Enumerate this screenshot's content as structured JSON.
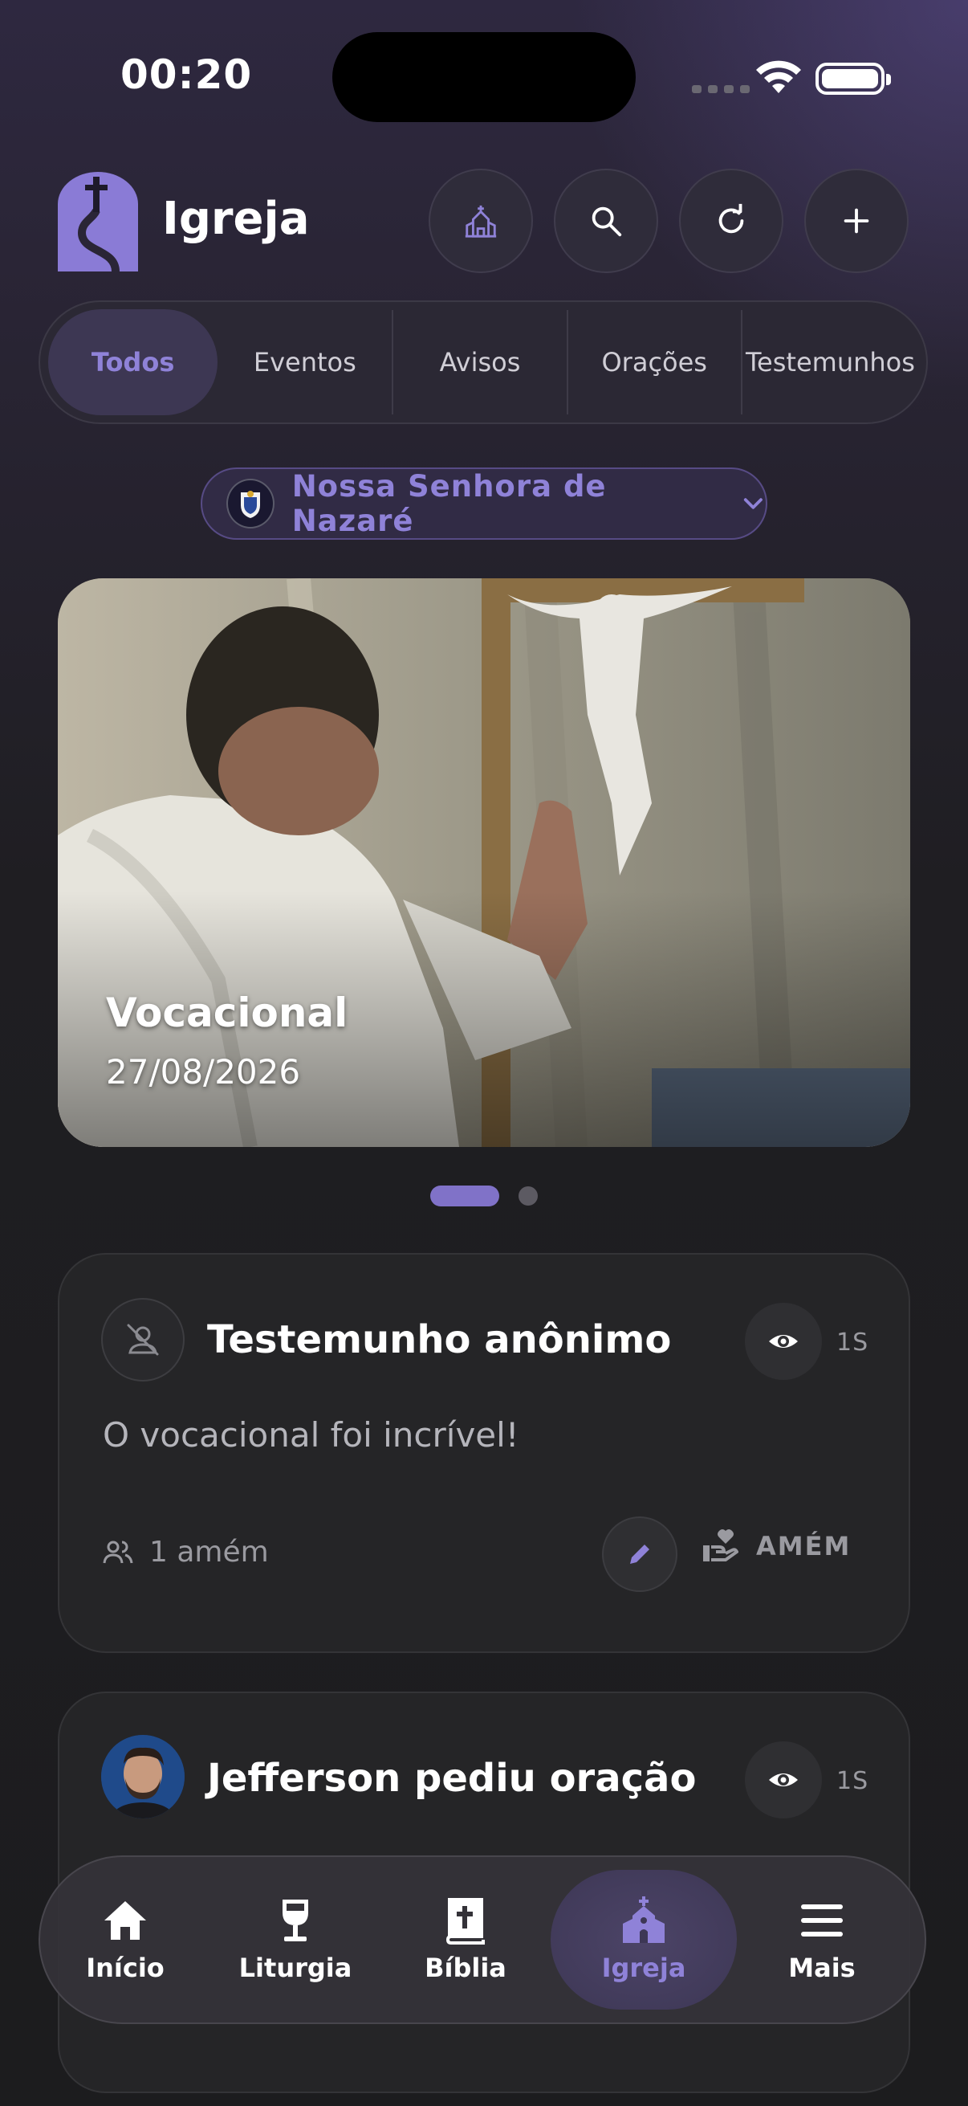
{
  "status_bar": {
    "time": "00:20"
  },
  "header": {
    "title": "Igreja",
    "buttons": [
      {
        "icon": "church-icon"
      },
      {
        "icon": "search-icon"
      },
      {
        "icon": "refresh-icon"
      },
      {
        "icon": "plus-icon"
      }
    ]
  },
  "filters": {
    "tabs": [
      {
        "label": "Todos",
        "active": true
      },
      {
        "label": "Eventos"
      },
      {
        "label": "Avisos"
      },
      {
        "label": "Orações"
      },
      {
        "label": "Testemunhos"
      }
    ]
  },
  "parish_selector": {
    "name": "Nossa Senhora de Nazaré",
    "icon": "chevron-down-icon"
  },
  "carousel": {
    "slides": [
      {
        "title": "Vocacional",
        "date": "27/08/2026"
      }
    ],
    "active_index": 0,
    "count": 2
  },
  "feed": [
    {
      "author_label": "Testemunho anônimo",
      "time_ago": "1S",
      "body": "O vocacional foi incrível!",
      "amen_count": "1 amém",
      "amen_button": "AMÉM"
    },
    {
      "author_label": "Jefferson pediu oração",
      "time_ago": "1S"
    }
  ],
  "bottom_nav": {
    "items": [
      {
        "label": "Início",
        "icon": "home-icon"
      },
      {
        "label": "Liturgia",
        "icon": "chalice-icon"
      },
      {
        "label": "Bíblia",
        "icon": "bible-icon"
      },
      {
        "label": "Igreja",
        "icon": "church-icon",
        "active": true
      },
      {
        "label": "Mais",
        "icon": "menu-icon"
      }
    ]
  },
  "colors": {
    "accent": "#8f82d8",
    "background": "#1c1c1e",
    "card": "#252527"
  }
}
